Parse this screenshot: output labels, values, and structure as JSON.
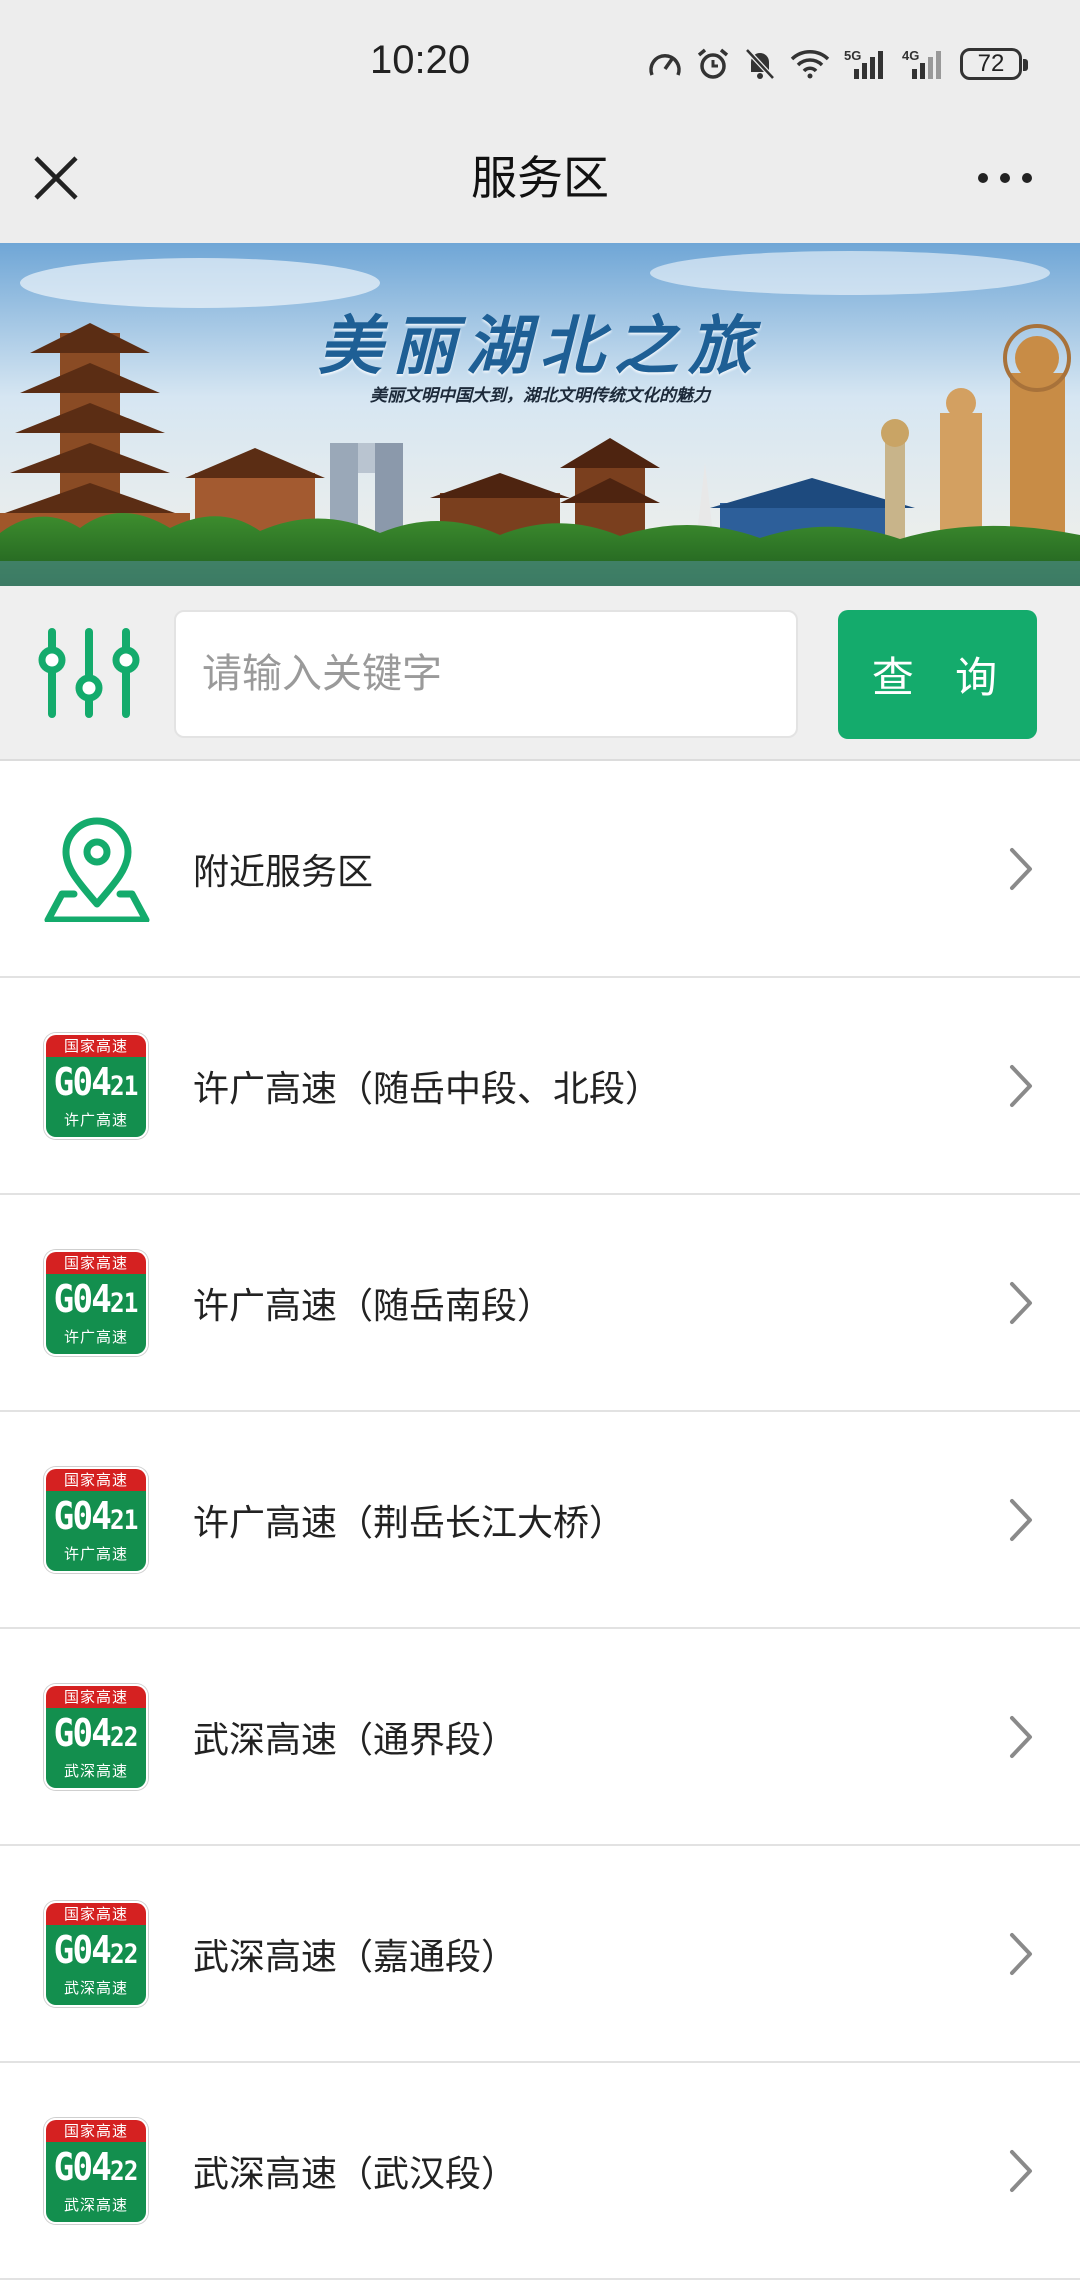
{
  "status_bar": {
    "time": "10:20",
    "battery": "72",
    "icons": [
      "speedometer-icon",
      "alarm-icon",
      "bell-off-icon",
      "wifi-icon",
      "5g-signal-icon",
      "4g-signal-icon",
      "battery-icon"
    ]
  },
  "nav": {
    "title": "服务区",
    "close_icon": "close-icon",
    "more_icon": "more-icon"
  },
  "banner": {
    "title": "美丽湖北之旅",
    "subtitle": "美丽文明中国大到，湖北文明传统文化的魅力"
  },
  "search": {
    "placeholder": "请输入关键字",
    "value": "",
    "button_label": "查 询",
    "filter_icon": "filter-sliders-icon"
  },
  "list": [
    {
      "label": "附近服务区",
      "icon": "location-pin-icon"
    },
    {
      "label": "许广高速（随岳中段、北段）",
      "badge": {
        "top": "国家高速",
        "code_main": "G04",
        "code_sub": "21",
        "name": "许广高速"
      }
    },
    {
      "label": "许广高速（随岳南段）",
      "badge": {
        "top": "国家高速",
        "code_main": "G04",
        "code_sub": "21",
        "name": "许广高速"
      }
    },
    {
      "label": "许广高速（荆岳长江大桥）",
      "badge": {
        "top": "国家高速",
        "code_main": "G04",
        "code_sub": "21",
        "name": "许广高速"
      }
    },
    {
      "label": "武深高速（通界段）",
      "badge": {
        "top": "国家高速",
        "code_main": "G04",
        "code_sub": "22",
        "name": "武深高速"
      }
    },
    {
      "label": "武深高速（嘉通段）",
      "badge": {
        "top": "国家高速",
        "code_main": "G04",
        "code_sub": "22",
        "name": "武深高速"
      }
    },
    {
      "label": "武深高速（武汉段）",
      "badge": {
        "top": "国家高速",
        "code_main": "G04",
        "code_sub": "22",
        "name": "武深高速"
      }
    }
  ],
  "colors": {
    "accent": "#14ab6c",
    "badge_green": "#138f4e",
    "badge_red": "#d52121",
    "bar_bg": "#ededed"
  }
}
